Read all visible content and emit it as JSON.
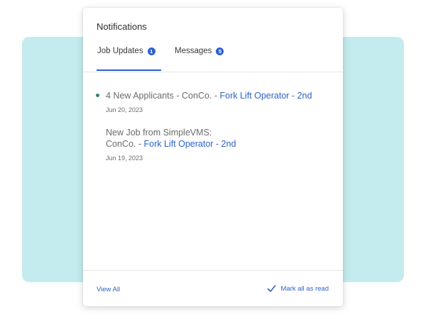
{
  "panel": {
    "title": "Notifications"
  },
  "tabs": [
    {
      "label": "Job Updates",
      "count": "1",
      "active": true
    },
    {
      "label": "Messages",
      "count": "5",
      "active": false
    }
  ],
  "notifications": [
    {
      "unread": true,
      "text": "4 New Applicants - ConCo. - ",
      "link": "Fork Lift Operator - 2nd",
      "date": "Jun 20, 2023"
    },
    {
      "unread": false,
      "text_line1": "New Job from SimpleVMS:",
      "text_line2": "ConCo. - ",
      "link": "Fork Lift Operator - 2nd",
      "date": "Jun 19, 2023"
    }
  ],
  "footer": {
    "view_all": "View All",
    "mark_all_read": "Mark all as read"
  },
  "colors": {
    "accent": "#2d5fd0",
    "link": "#2d62c8",
    "backdrop": "#c4ecee",
    "unread_dot": "#2e8b57"
  },
  "icons": {
    "mark_read": "check-icon"
  }
}
